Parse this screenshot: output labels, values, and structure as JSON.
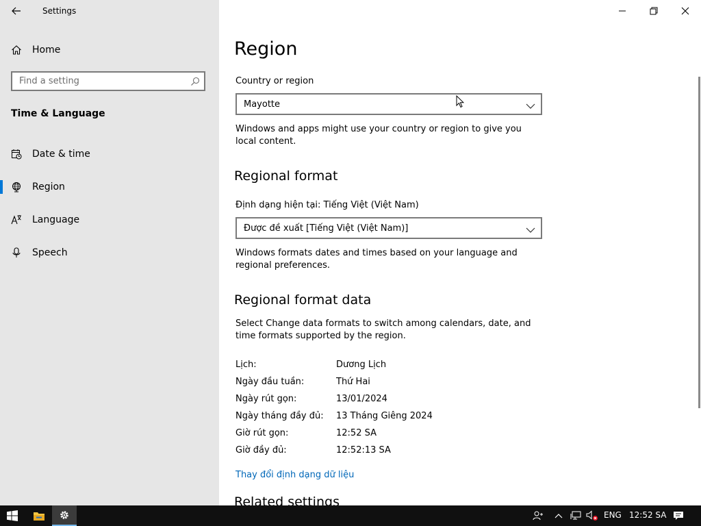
{
  "app": {
    "title": "Settings"
  },
  "sidebar": {
    "home_label": "Home",
    "search_placeholder": "Find a setting",
    "section_title": "Time & Language",
    "items": [
      {
        "label": "Date & time",
        "icon": "calendar-clock-icon",
        "active": false
      },
      {
        "label": "Region",
        "icon": "globe-icon",
        "active": true
      },
      {
        "label": "Language",
        "icon": "language-icon",
        "active": false
      },
      {
        "label": "Speech",
        "icon": "microphone-icon",
        "active": false
      }
    ]
  },
  "main": {
    "title": "Region",
    "country": {
      "label": "Country or region",
      "value": "Mayotte",
      "description": "Windows and apps might use your country or region to give you local content."
    },
    "regional_format": {
      "heading": "Regional format",
      "current_label": "Định dạng hiện tại: Tiếng Việt (Việt Nam)",
      "value": "Được đề xuất [Tiếng Việt (Việt Nam)]",
      "description": "Windows formats dates and times based on your language and regional preferences."
    },
    "format_data": {
      "heading": "Regional format data",
      "description": "Select Change data formats to switch among calendars, date, and time formats supported by the region.",
      "rows": [
        {
          "key": "Lịch:",
          "value": "Dương Lịch"
        },
        {
          "key": "Ngày đầu tuần:",
          "value": "Thứ Hai"
        },
        {
          "key": "Ngày rút gọn:",
          "value": "13/01/2024"
        },
        {
          "key": "Ngày tháng đầy đủ:",
          "value": "13 Tháng Giêng 2024"
        },
        {
          "key": "Giờ rút gọn:",
          "value": "12:52 SA"
        },
        {
          "key": "Giờ đầy đủ:",
          "value": "12:52:13 SA"
        }
      ],
      "change_link": "Thay đổi định dạng dữ liệu"
    },
    "related_heading": "Related settings"
  },
  "taskbar": {
    "language": "ENG",
    "time": "12:52 SA"
  },
  "colors": {
    "accent": "#0078d7",
    "link": "#0067b8",
    "sidebar_bg": "#e6e6e6",
    "taskbar_bg": "#101010"
  }
}
